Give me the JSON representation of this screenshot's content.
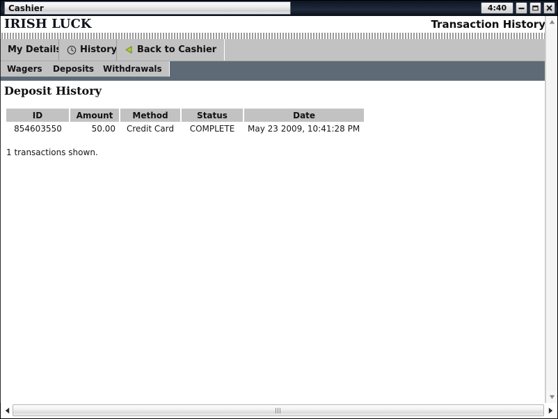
{
  "window": {
    "title": "Cashier",
    "clock": "4:40",
    "controls": [
      {
        "name": "minimize",
        "label": "Minimize"
      },
      {
        "name": "restore",
        "label": "Restore"
      },
      {
        "name": "close",
        "label": "Close"
      }
    ]
  },
  "header": {
    "brand": "IRISH LUCK",
    "page_title": "Transaction History"
  },
  "tabs": [
    {
      "label": "My Details",
      "icon": "",
      "active": false
    },
    {
      "label": "History",
      "icon": "clock-icon",
      "active": true
    },
    {
      "label": "Back to Cashier",
      "icon": "back-arrow-icon",
      "active": false
    }
  ],
  "subtabs": [
    {
      "label": "Wagers",
      "active": false
    },
    {
      "label": "Deposits",
      "active": true
    },
    {
      "label": "Withdrawals",
      "active": false
    }
  ],
  "main": {
    "section_title": "Deposit History",
    "table": {
      "columns": [
        "ID",
        "Amount",
        "Method",
        "Status",
        "Date"
      ],
      "rows": [
        {
          "id": "854603550",
          "amount": "50.00",
          "method": "Credit Card",
          "status": "COMPLETE",
          "date": "May 23 2009, 10:41:28 PM"
        }
      ]
    },
    "count_text": "1 transactions shown."
  },
  "colors": {
    "titlebar": "#16202e",
    "tabstrip": "#c2c2c2",
    "subband": "#5e6b76",
    "table_header": "#c2c2c2",
    "back_arrow": "#a5c63b",
    "text": "#161616"
  }
}
